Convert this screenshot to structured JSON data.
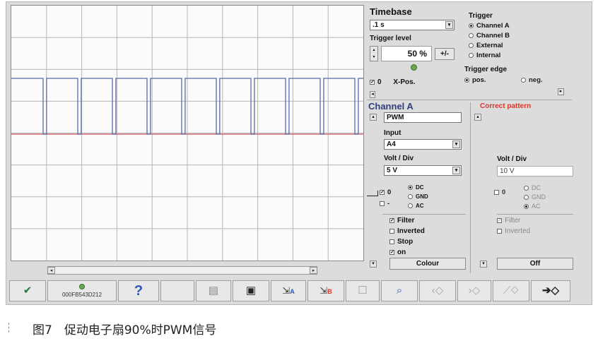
{
  "timebase": {
    "title": "Timebase",
    "value": ".1 s"
  },
  "trigger_level": {
    "label": "Trigger level",
    "value": "50 %",
    "invert_label": "+/-"
  },
  "trigger": {
    "title": "Trigger",
    "options": [
      "Channel A",
      "Channel B",
      "External",
      "Internal"
    ],
    "selected": "Channel A"
  },
  "trigger_edge": {
    "title": "Trigger edge",
    "pos": "pos.",
    "neg": "neg.",
    "selected": "pos."
  },
  "xpos": {
    "zero": "0",
    "label": "X-Pos."
  },
  "channel_a": {
    "title": "Channel A",
    "name": "PWM",
    "input_label": "Input",
    "input_value": "A4",
    "volt_label": "Volt / Div",
    "volt_value": "5 V",
    "zero": "0",
    "dash": "-",
    "coupling": [
      "DC",
      "GND",
      "AC"
    ],
    "filter": "Filter",
    "inverted": "Inverted",
    "stop": "Stop",
    "on": "on",
    "colour": "Colour"
  },
  "correct_pattern": {
    "title": "Correct pattern",
    "volt_label": "Volt / Div",
    "volt_value": "10 V",
    "zero": "0",
    "coupling": [
      "DC",
      "GND",
      "AC"
    ],
    "filter": "Filter",
    "inverted": "Inverted",
    "off": "Off"
  },
  "toolbar": {
    "device_id": "000FB543D212",
    "help": "?"
  },
  "caption": "图7　促动电子扇90%时PWM信号",
  "colors": {
    "signal": "#5a6aa8",
    "baseline": "#d2555b",
    "alert": "#d8362a"
  },
  "chart_data": {
    "type": "line",
    "series": [
      {
        "values_description": "square wave",
        "duty_cycle_percent": 90
      }
    ],
    "grid": true
  }
}
